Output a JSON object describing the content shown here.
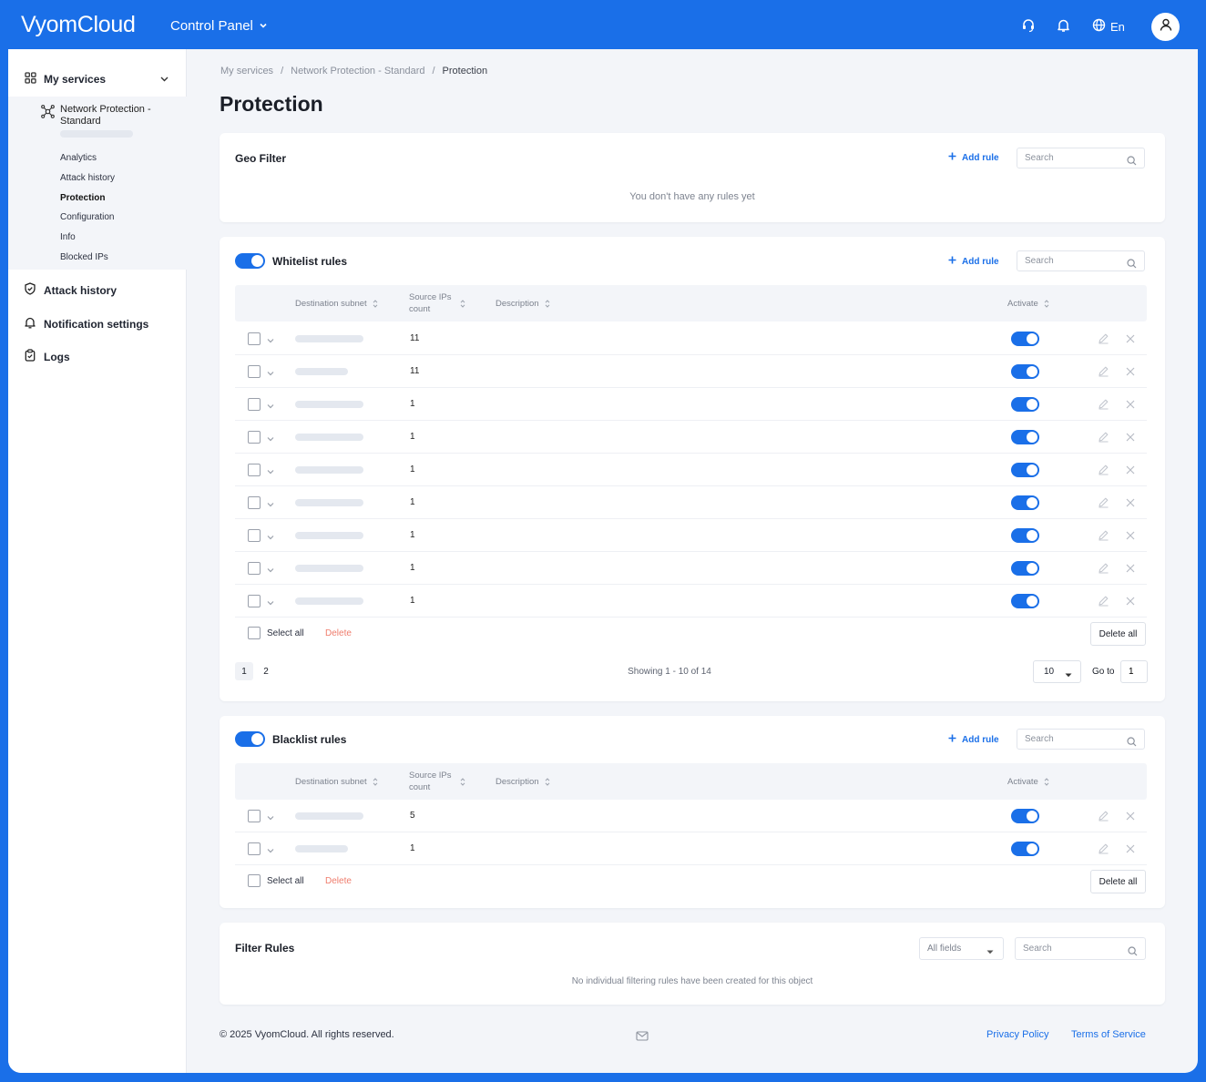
{
  "header": {
    "logo": "VyomCloud",
    "panel_label": "Control Panel",
    "language": "En",
    "icons": [
      "headset-icon",
      "bell-icon",
      "globe-icon",
      "user-icon"
    ]
  },
  "sidebar": {
    "my_services": "My services",
    "service_name": "Network Protection - Standard",
    "sub_items": [
      {
        "label": "Analytics",
        "active": false
      },
      {
        "label": "Attack history",
        "active": false
      },
      {
        "label": "Protection",
        "active": true
      },
      {
        "label": "Configuration",
        "active": false
      },
      {
        "label": "Info",
        "active": false
      },
      {
        "label": "Blocked IPs",
        "active": false
      }
    ],
    "nav": [
      {
        "label": "Attack history",
        "icon": "shield-icon"
      },
      {
        "label": "Notification settings",
        "icon": "bell-icon"
      },
      {
        "label": "Logs",
        "icon": "clipboard-icon"
      }
    ]
  },
  "breadcrumb": [
    "My services",
    "Network Protection - Standard",
    "Protection"
  ],
  "page_title": "Protection",
  "geo_filter": {
    "title": "Geo Filter",
    "add_rule": "Add rule",
    "search_placeholder": "Search",
    "empty": "You don't have any rules yet"
  },
  "whitelist": {
    "title": "Whitelist rules",
    "enabled": true,
    "add_rule": "Add rule",
    "search_placeholder": "Search",
    "columns": {
      "destination": "Destination subnet",
      "source": "Source IPs count",
      "description": "Description",
      "activate": "Activate"
    },
    "rows": [
      {
        "source_count": "11",
        "active": true
      },
      {
        "source_count": "11",
        "active": true
      },
      {
        "source_count": "1",
        "active": true
      },
      {
        "source_count": "1",
        "active": true
      },
      {
        "source_count": "1",
        "active": true
      },
      {
        "source_count": "1",
        "active": true
      },
      {
        "source_count": "1",
        "active": true
      },
      {
        "source_count": "1",
        "active": true
      },
      {
        "source_count": "1",
        "active": true
      }
    ],
    "select_all": "Select all",
    "delete": "Delete",
    "delete_all": "Delete all",
    "pages": [
      "1",
      "2"
    ],
    "current_page": "1",
    "showing": "Showing 1 - 10 of 14",
    "page_size": "10",
    "goto_label": "Go to",
    "goto_value": "1"
  },
  "blacklist": {
    "title": "Blacklist rules",
    "enabled": true,
    "add_rule": "Add rule",
    "search_placeholder": "Search",
    "columns": {
      "destination": "Destination subnet",
      "source": "Source IPs count",
      "description": "Description",
      "activate": "Activate"
    },
    "rows": [
      {
        "source_count": "5",
        "active": true
      },
      {
        "source_count": "1",
        "active": true
      }
    ],
    "select_all": "Select all",
    "delete": "Delete",
    "delete_all": "Delete all"
  },
  "filter_rules": {
    "title": "Filter Rules",
    "field_select": "All fields",
    "search_placeholder": "Search",
    "empty": "No individual filtering rules have been created for this object"
  },
  "footer": {
    "copyright": "© 2025 VyomCloud. All rights reserved.",
    "privacy": "Privacy Policy",
    "terms": "Terms of Service"
  },
  "colors": {
    "accent": "#1a6fe8",
    "danger": "#ef7c6c",
    "background": "#f3f5f9"
  }
}
